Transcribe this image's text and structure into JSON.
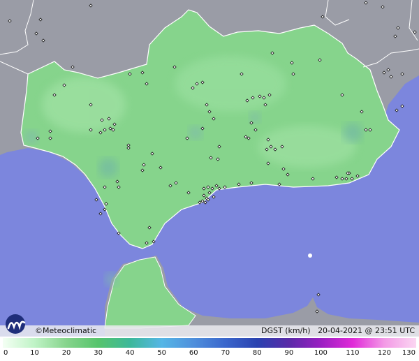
{
  "map": {
    "colors": {
      "sea": "#7c86dd",
      "land_outside": "#9a9ca6",
      "region_fill": "#86d48c",
      "region_fill_light": "#9be0a0",
      "border": "#ffffff",
      "station_marker": "#111111"
    }
  },
  "logo": {
    "icon": "meteoclimatic-logo-icon"
  },
  "credit": {
    "text": "©Meteoclimatic"
  },
  "caption": {
    "variable": "DGST (km/h)",
    "date": "20-04-2021",
    "time": "@ 23:51 UTC"
  },
  "legend": {
    "unit": "km/h",
    "ticks": [
      "0",
      "10",
      "20",
      "30",
      "40",
      "50",
      "60",
      "70",
      "80",
      "90",
      "100",
      "110",
      "120",
      "130"
    ],
    "tick_values": [
      0,
      10,
      20,
      30,
      40,
      50,
      60,
      70,
      80,
      90,
      100,
      110,
      120,
      130
    ],
    "range": [
      0,
      130
    ],
    "stops": [
      {
        "value": 0,
        "color": "#f4fff4"
      },
      {
        "value": 10,
        "color": "#bff3c6"
      },
      {
        "value": 20,
        "color": "#86d48c"
      },
      {
        "value": 30,
        "color": "#56c46c"
      },
      {
        "value": 40,
        "color": "#3cb89a"
      },
      {
        "value": 50,
        "color": "#55b6e6"
      },
      {
        "value": 60,
        "color": "#4f8fdc"
      },
      {
        "value": 70,
        "color": "#3a66cc"
      },
      {
        "value": 80,
        "color": "#2a42b0"
      },
      {
        "value": 90,
        "color": "#5a2aa8"
      },
      {
        "value": 100,
        "color": "#9a1fc2"
      },
      {
        "value": 110,
        "color": "#e02ad8"
      },
      {
        "value": 120,
        "color": "#f39ae6"
      },
      {
        "value": 130,
        "color": "#fbd6f2"
      }
    ]
  }
}
